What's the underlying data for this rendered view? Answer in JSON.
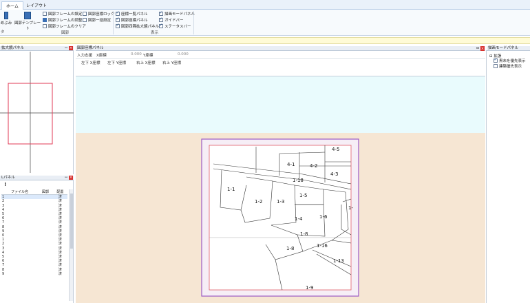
{
  "tabs": [
    "ホーム",
    "レイアウト"
  ],
  "ribbon": {
    "left_cut_label": "めぶみ",
    "left_group_label": "タ",
    "template_button": "図郭テンプレート",
    "drawing_items": [
      "図郭フレームの設定",
      "図郭フレームの調整",
      "図郭フレームのクリア"
    ],
    "drawing_items2": [
      "図郭座標ロック",
      "図郭一括設定"
    ],
    "drawing_group": "図郭",
    "display_items": [
      "座標一覧パネル",
      "図郭座標パネル",
      "図郭四隅拡大鏡パネル"
    ],
    "display_items2": [
      "描画モードパネル",
      "ガイドバー",
      "ステータスバー"
    ],
    "display_group": "表示"
  },
  "magnify_panel": {
    "title": "拡大鏡パネル"
  },
  "file_panel": {
    "title": "Lパネル",
    "headers": [
      "ファイル名",
      "図郭",
      "配置"
    ],
    "rows": [
      [
        "1",
        "",
        "済"
      ],
      [
        "2",
        "",
        "済"
      ],
      [
        "3",
        "",
        "済"
      ],
      [
        "4",
        "",
        "済"
      ],
      [
        "5",
        "",
        "済"
      ],
      [
        "6",
        "",
        "済"
      ],
      [
        "7",
        "",
        "済"
      ],
      [
        "8",
        "",
        "済"
      ],
      [
        "9",
        "",
        "済"
      ],
      [
        "0",
        "",
        "済"
      ],
      [
        "1",
        "",
        "済"
      ],
      [
        "2",
        "",
        "済"
      ],
      [
        "3",
        "",
        "済"
      ],
      [
        "4",
        "",
        "済"
      ],
      [
        "5",
        "",
        "済"
      ],
      [
        "6",
        "",
        "済"
      ],
      [
        "7",
        "",
        "済"
      ],
      [
        "8",
        "",
        "済"
      ],
      [
        "9",
        "",
        "済"
      ]
    ]
  },
  "coord_panel": {
    "title": "図郭座標パネル",
    "input_label": "入力支援",
    "x_label": "X座標",
    "x_value": "0.000",
    "y_label": "Y座標",
    "y_value": "0.000",
    "corners": [
      "左下 X座標",
      "左下 Y座標",
      "右上 X座標",
      "右上 Y座標"
    ]
  },
  "right_panel": {
    "title": "描画モードパネル",
    "tree_root": "拡張",
    "options": [
      {
        "label": "黒未を優先表示",
        "checked": true
      },
      {
        "label": "建築優先表示",
        "checked": false
      }
    ]
  },
  "map": {
    "parcels": [
      "4-5",
      "4-1",
      "4-2",
      "4-3",
      "1-18",
      "1-1",
      "1-2",
      "1-3",
      "1-5",
      "1-4",
      "1-6",
      "1-8",
      "1-8",
      "1-16",
      "1-13",
      "1-9",
      "1-"
    ]
  }
}
